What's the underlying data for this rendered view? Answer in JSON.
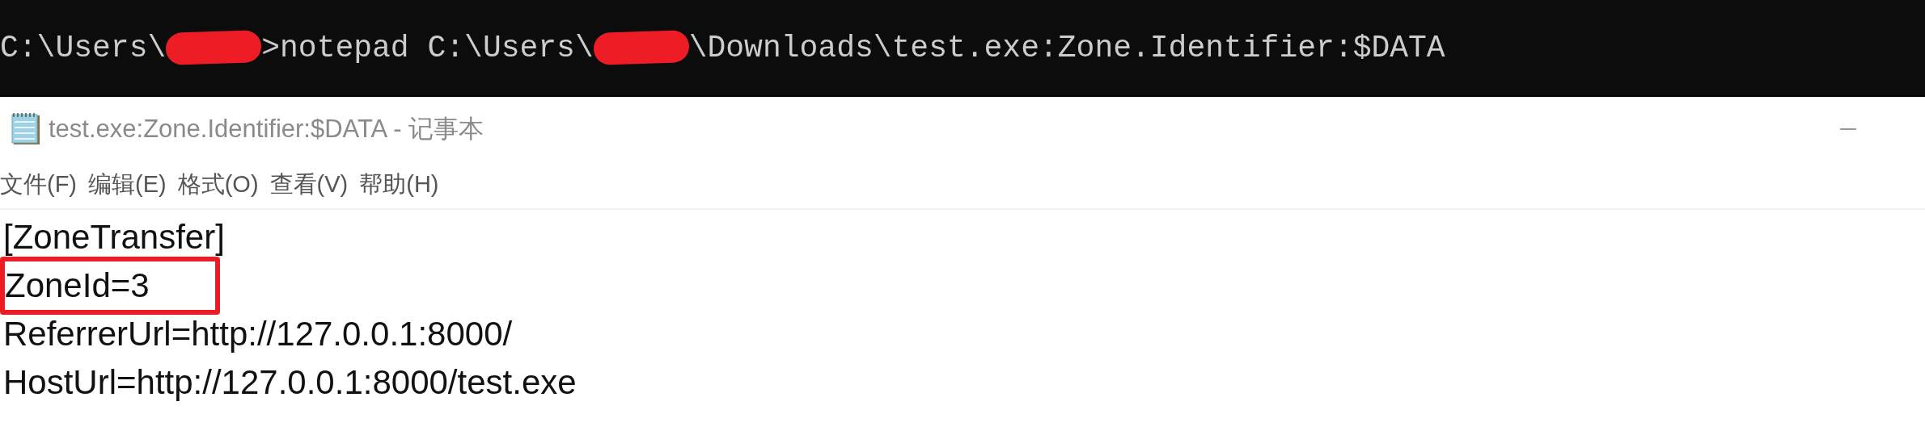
{
  "console": {
    "line": [
      {
        "kind": "text",
        "text": "C:\\Users\\"
      },
      {
        "kind": "redacted"
      },
      {
        "kind": "text",
        "text": ">notepad C:\\Users\\"
      },
      {
        "kind": "redacted"
      },
      {
        "kind": "text",
        "text": "\\Downloads\\test.exe:Zone.Identifier:$DATA"
      }
    ]
  },
  "window": {
    "title": "test.exe:Zone.Identifier:$DATA - 记事本"
  },
  "menu": [
    "文件(F)",
    "编辑(E)",
    "格式(O)",
    "查看(V)",
    "帮助(H)"
  ],
  "content": [
    {
      "text": "[ZoneTransfer]",
      "highlighted": false
    },
    {
      "text": "ZoneId=3",
      "highlighted": true
    },
    {
      "text": "ReferrerUrl=http://127.0.0.1:8000/",
      "highlighted": false
    },
    {
      "text": "HostUrl=http://127.0.0.1:8000/test.exe",
      "highlighted": false
    }
  ]
}
